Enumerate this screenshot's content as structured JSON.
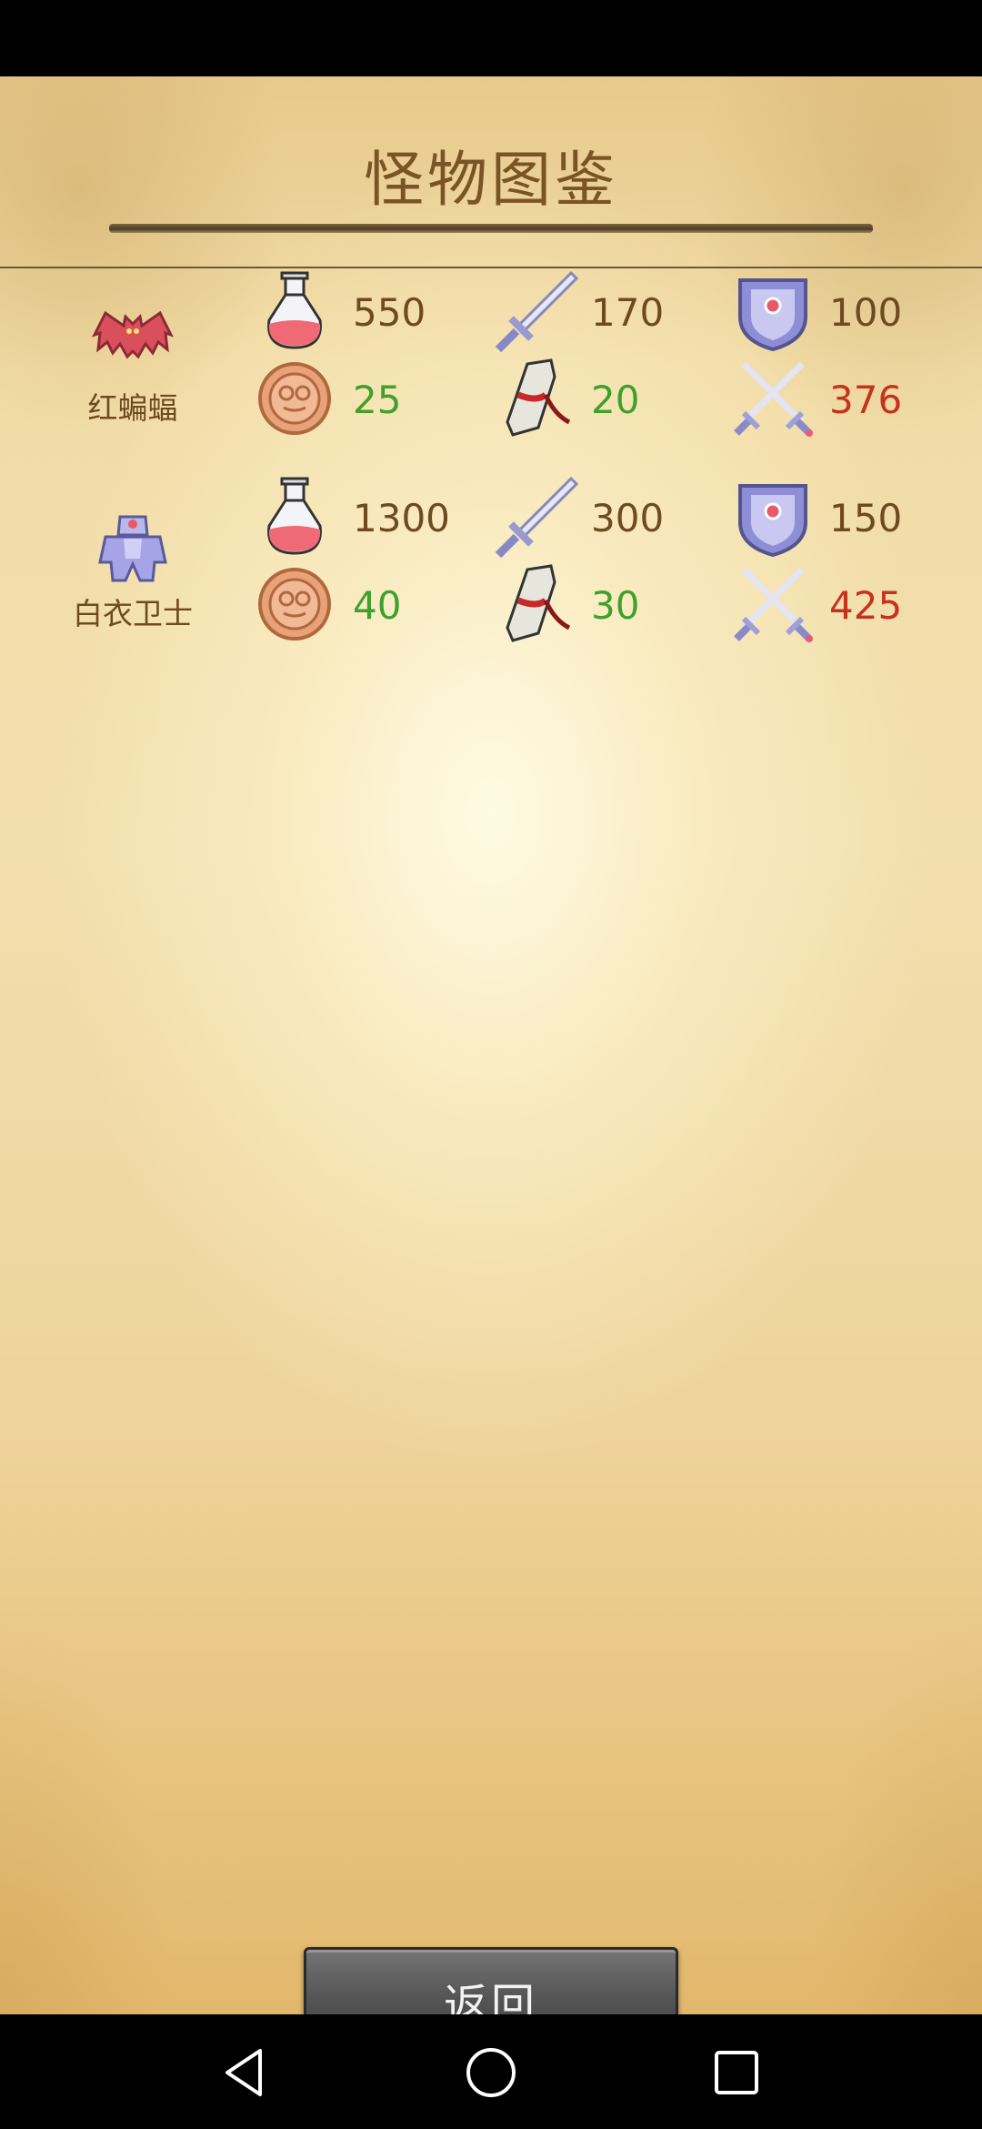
{
  "header": {
    "title": "怪物图鉴"
  },
  "monsters": [
    {
      "name": "红蝙蝠",
      "icon": "red-bat-icon",
      "hp": "550",
      "attack": "170",
      "defense": "100",
      "gold": "25",
      "exp": "20",
      "damage": "376"
    },
    {
      "name": "白衣卫士",
      "icon": "white-guard-icon",
      "hp": "1300",
      "attack": "300",
      "defense": "150",
      "gold": "40",
      "exp": "30",
      "damage": "425"
    }
  ],
  "footer": {
    "back_label": "返回"
  },
  "colors": {
    "title": "#7a5424",
    "reward": "#3fa02c",
    "damage": "#c6321c",
    "stat": "#6e4a20"
  },
  "icons": [
    "potion-icon",
    "sword-icon",
    "shield-icon",
    "coin-icon",
    "scroll-icon",
    "crossed-swords-icon"
  ]
}
